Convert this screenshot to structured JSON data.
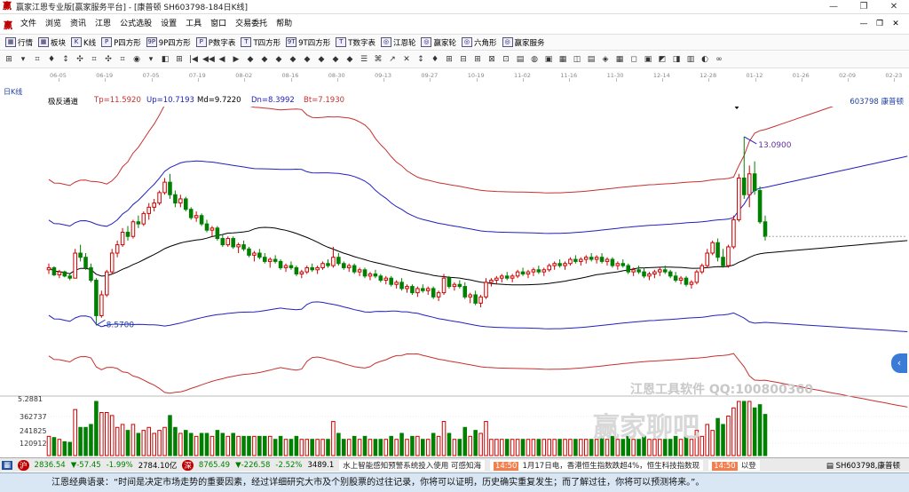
{
  "window": {
    "title": "赢家江恩专业版[赢家服务平台] - [康普顿  SH603798-184日K线]",
    "logo": "赢",
    "controls": [
      "—",
      "❐",
      "✕"
    ]
  },
  "menu": {
    "logo": "赢",
    "items": [
      "文件",
      "浏览",
      "资讯",
      "江恩",
      "公式选股",
      "设置",
      "工具",
      "窗口",
      "交易委托",
      "帮助"
    ],
    "mdi_controls": [
      "—",
      "❐",
      "✕"
    ]
  },
  "toolbar1": {
    "items": [
      {
        "icon": "grid-icon",
        "glyph": "▦",
        "label": "行情"
      },
      {
        "icon": "block-icon",
        "glyph": "▦",
        "label": "板块"
      },
      {
        "icon": "kline-icon",
        "glyph": "K",
        "label": "K线"
      },
      {
        "icon": "p-square-icon",
        "glyph": "P",
        "label": "P四方形"
      },
      {
        "icon": "9p-square-icon",
        "glyph": "9P",
        "label": "9P四方形"
      },
      {
        "icon": "p-number-icon",
        "glyph": "P",
        "label": "P数字表"
      },
      {
        "icon": "t-square-icon",
        "glyph": "T",
        "label": "T四方形"
      },
      {
        "icon": "9t-square-icon",
        "glyph": "9T",
        "label": "9T四方形"
      },
      {
        "icon": "t-number-icon",
        "glyph": "T",
        "label": "T数字表"
      },
      {
        "icon": "gann-wheel-icon",
        "glyph": "◎",
        "label": "江恩轮"
      },
      {
        "icon": "winner-wheel-icon",
        "glyph": "◎",
        "label": "赢家轮"
      },
      {
        "icon": "hexagon-icon",
        "glyph": "◎",
        "label": "六角形"
      },
      {
        "icon": "service-icon",
        "glyph": "◎",
        "label": "赢家服务"
      }
    ]
  },
  "toolbar2": {
    "glyphs": [
      "⊞",
      "▾",
      "⌗",
      "♦",
      "↕",
      "✣",
      "⌗",
      "✣",
      "⌗",
      "◉",
      "▾",
      "◧",
      "⊞",
      "|◀",
      "◀◀",
      "◀",
      "▶",
      "◆",
      "◆",
      "◆",
      "◆",
      "◆",
      "◆",
      "◆",
      "◆",
      "☰",
      "⌘",
      "↗",
      "✕",
      "↕",
      "♦",
      "⊞",
      "⊟",
      "⊞",
      "⊠",
      "⊡",
      "▤",
      "◍",
      "▣",
      "▦",
      "◫",
      "▤",
      "◈",
      "▦",
      "◻",
      "▣",
      "◩",
      "◨",
      "▥",
      "◐",
      "∞"
    ]
  },
  "date_axis": {
    "label": "日K线",
    "dates": [
      "06-05",
      "06-19",
      "07-05",
      "07-19",
      "08-02",
      "08-16",
      "08-30",
      "09-13",
      "09-27",
      "10-19",
      "11-02",
      "11-16",
      "11-30",
      "12-14",
      "12-28",
      "01-12",
      "01-26",
      "02-09",
      "02-23"
    ]
  },
  "indicator": {
    "name": "极反通道",
    "tp": "Tp=11.5920",
    "up": "Up=10.7193",
    "md": "Md=9.7220",
    "dn": "Dn=8.3992",
    "bt": "Bt=7.1930",
    "stock_code": "603798",
    "stock_name": "康普顿"
  },
  "colors": {
    "up": "#d00000",
    "down": "#008000",
    "upper_band": "#c83030",
    "mid_band": "#2020c0",
    "ma_line": "#000000"
  },
  "chart_data": {
    "type": "candlestick",
    "price_range": [
      7.0,
      13.6
    ],
    "annotations": {
      "high_label": "13.0900",
      "low_label": "8.5700",
      "volume_scale_top": "5.2881"
    },
    "volume_ticks": [
      "362737",
      "241825",
      "120912"
    ],
    "candles": [
      [
        9.9,
        10.05,
        9.8,
        9.95
      ],
      [
        9.95,
        9.98,
        9.75,
        9.78
      ],
      [
        9.78,
        9.9,
        9.7,
        9.85
      ],
      [
        9.85,
        9.88,
        9.72,
        9.75
      ],
      [
        9.75,
        9.8,
        9.65,
        9.7
      ],
      [
        9.7,
        10.4,
        9.7,
        10.3
      ],
      [
        10.3,
        10.5,
        10.1,
        10.2
      ],
      [
        10.2,
        10.3,
        9.9,
        9.95
      ],
      [
        9.95,
        10.05,
        9.6,
        9.65
      ],
      [
        9.65,
        9.7,
        8.57,
        8.8
      ],
      [
        8.8,
        9.4,
        8.75,
        9.3
      ],
      [
        9.3,
        9.9,
        9.25,
        9.85
      ],
      [
        9.85,
        10.4,
        9.8,
        10.3
      ],
      [
        10.3,
        10.6,
        10.2,
        10.5
      ],
      [
        10.5,
        10.9,
        10.45,
        10.8
      ],
      [
        10.8,
        10.95,
        10.6,
        10.7
      ],
      [
        10.7,
        11.1,
        10.65,
        11.05
      ],
      [
        11.05,
        11.2,
        10.9,
        11.0
      ],
      [
        11.0,
        11.3,
        10.95,
        11.25
      ],
      [
        11.25,
        11.5,
        11.1,
        11.4
      ],
      [
        11.4,
        11.6,
        11.3,
        11.5
      ],
      [
        11.5,
        11.8,
        11.45,
        11.75
      ],
      [
        11.75,
        12.1,
        11.7,
        12.0
      ],
      [
        12.0,
        12.2,
        11.6,
        11.7
      ],
      [
        11.7,
        11.8,
        11.4,
        11.5
      ],
      [
        11.5,
        11.7,
        11.4,
        11.6
      ],
      [
        11.6,
        11.65,
        11.3,
        11.35
      ],
      [
        11.35,
        11.4,
        11.1,
        11.15
      ],
      [
        11.15,
        11.3,
        11.05,
        11.2
      ],
      [
        11.2,
        11.25,
        10.95,
        11.0
      ],
      [
        11.0,
        11.1,
        10.8,
        10.85
      ],
      [
        10.85,
        10.95,
        10.7,
        10.9
      ],
      [
        10.9,
        10.95,
        10.6,
        10.65
      ],
      [
        10.65,
        10.75,
        10.45,
        10.5
      ],
      [
        10.5,
        10.7,
        10.45,
        10.65
      ],
      [
        10.65,
        10.7,
        10.4,
        10.45
      ],
      [
        10.45,
        10.55,
        10.3,
        10.5
      ],
      [
        10.5,
        10.6,
        10.35,
        10.4
      ],
      [
        10.4,
        10.45,
        10.2,
        10.25
      ],
      [
        10.25,
        10.35,
        10.1,
        10.3
      ],
      [
        10.3,
        10.4,
        10.15,
        10.2
      ],
      [
        10.2,
        10.3,
        10.05,
        10.1
      ],
      [
        10.1,
        10.2,
        9.95,
        10.15
      ],
      [
        10.15,
        10.25,
        10.05,
        10.1
      ],
      [
        10.1,
        10.15,
        9.9,
        9.95
      ],
      [
        9.95,
        10.05,
        9.85,
        10.0
      ],
      [
        10.0,
        10.1,
        9.9,
        9.95
      ],
      [
        9.95,
        10.0,
        9.75,
        9.8
      ],
      [
        9.8,
        9.9,
        9.7,
        9.85
      ],
      [
        9.85,
        10.0,
        9.8,
        9.95
      ],
      [
        9.95,
        10.05,
        9.85,
        9.9
      ],
      [
        9.9,
        10.0,
        9.8,
        9.95
      ],
      [
        9.95,
        10.1,
        9.9,
        10.05
      ],
      [
        10.05,
        10.15,
        9.95,
        10.0
      ],
      [
        10.0,
        10.45,
        9.95,
        10.2
      ],
      [
        10.2,
        10.3,
        10.0,
        10.05
      ],
      [
        10.05,
        10.1,
        9.9,
        9.95
      ],
      [
        9.95,
        10.05,
        9.85,
        10.0
      ],
      [
        10.0,
        10.05,
        9.8,
        9.85
      ],
      [
        9.85,
        9.95,
        9.75,
        9.9
      ],
      [
        9.9,
        9.95,
        9.7,
        9.75
      ],
      [
        9.75,
        9.85,
        9.65,
        9.8
      ],
      [
        9.8,
        9.9,
        9.7,
        9.75
      ],
      [
        9.75,
        9.8,
        9.6,
        9.65
      ],
      [
        9.65,
        9.75,
        9.55,
        9.7
      ],
      [
        9.7,
        9.75,
        9.5,
        9.55
      ],
      [
        9.55,
        9.65,
        9.45,
        9.6
      ],
      [
        9.6,
        9.7,
        9.4,
        9.45
      ],
      [
        9.45,
        9.55,
        9.35,
        9.5
      ],
      [
        9.5,
        9.55,
        9.3,
        9.35
      ],
      [
        9.35,
        9.5,
        9.25,
        9.45
      ],
      [
        9.45,
        9.55,
        9.35,
        9.4
      ],
      [
        9.4,
        9.5,
        9.3,
        9.45
      ],
      [
        9.45,
        9.5,
        9.2,
        9.25
      ],
      [
        9.25,
        9.4,
        9.15,
        9.35
      ],
      [
        9.35,
        9.8,
        9.3,
        9.7
      ],
      [
        9.7,
        9.75,
        9.45,
        9.5
      ],
      [
        9.5,
        9.6,
        9.4,
        9.55
      ],
      [
        9.55,
        9.65,
        9.45,
        9.5
      ],
      [
        9.5,
        9.6,
        9.2,
        9.25
      ],
      [
        9.25,
        9.35,
        9.1,
        9.3
      ],
      [
        9.3,
        9.4,
        9.05,
        9.1
      ],
      [
        9.1,
        9.3,
        9.0,
        9.25
      ],
      [
        9.25,
        9.7,
        9.2,
        9.6
      ],
      [
        9.6,
        9.7,
        9.5,
        9.65
      ],
      [
        9.65,
        9.75,
        9.55,
        9.7
      ],
      [
        9.7,
        9.8,
        9.6,
        9.75
      ],
      [
        9.75,
        9.85,
        9.65,
        9.7
      ],
      [
        9.7,
        9.8,
        9.6,
        9.75
      ],
      [
        9.75,
        9.9,
        9.7,
        9.85
      ],
      [
        9.85,
        9.95,
        9.75,
        9.8
      ],
      [
        9.8,
        9.9,
        9.7,
        9.85
      ],
      [
        9.85,
        9.95,
        9.75,
        9.9
      ],
      [
        9.9,
        10.0,
        9.8,
        9.85
      ],
      [
        9.85,
        9.95,
        9.75,
        9.9
      ],
      [
        9.9,
        10.05,
        9.85,
        10.0
      ],
      [
        10.0,
        10.1,
        9.9,
        10.05
      ],
      [
        10.05,
        10.15,
        9.95,
        10.0
      ],
      [
        10.0,
        10.1,
        9.9,
        10.05
      ],
      [
        10.05,
        10.2,
        10.0,
        10.15
      ],
      [
        10.15,
        10.25,
        10.05,
        10.1
      ],
      [
        10.1,
        10.2,
        10.0,
        10.15
      ],
      [
        10.15,
        10.25,
        10.05,
        10.2
      ],
      [
        10.2,
        10.3,
        10.1,
        10.15
      ],
      [
        10.15,
        10.25,
        10.05,
        10.2
      ],
      [
        10.2,
        10.3,
        10.05,
        10.1
      ],
      [
        10.1,
        10.2,
        10.0,
        10.15
      ],
      [
        10.15,
        10.2,
        9.95,
        10.0
      ],
      [
        10.0,
        10.1,
        9.9,
        10.05
      ],
      [
        10.05,
        10.15,
        9.95,
        10.0
      ],
      [
        10.0,
        10.05,
        9.8,
        9.85
      ],
      [
        9.85,
        9.95,
        9.75,
        9.9
      ],
      [
        9.9,
        10.0,
        9.8,
        9.85
      ],
      [
        9.85,
        9.95,
        9.7,
        9.75
      ],
      [
        9.75,
        9.85,
        9.65,
        9.8
      ],
      [
        9.8,
        9.9,
        9.7,
        9.85
      ],
      [
        9.85,
        9.95,
        9.75,
        9.9
      ],
      [
        9.9,
        10.0,
        9.8,
        9.85
      ],
      [
        9.85,
        9.9,
        9.7,
        9.75
      ],
      [
        9.75,
        9.85,
        9.6,
        9.65
      ],
      [
        9.65,
        9.75,
        9.55,
        9.7
      ],
      [
        9.7,
        9.75,
        9.5,
        9.55
      ],
      [
        9.55,
        9.65,
        9.45,
        9.6
      ],
      [
        9.6,
        9.9,
        9.55,
        9.85
      ],
      [
        9.85,
        10.05,
        9.8,
        10.0
      ],
      [
        10.0,
        10.4,
        9.95,
        10.3
      ],
      [
        10.3,
        10.6,
        10.25,
        10.55
      ],
      [
        10.55,
        10.65,
        10.1,
        10.2
      ],
      [
        10.2,
        10.4,
        9.95,
        10.0
      ],
      [
        10.0,
        10.5,
        9.95,
        10.45
      ],
      [
        10.45,
        11.2,
        10.4,
        11.1
      ],
      [
        11.1,
        12.2,
        11.05,
        12.1
      ],
      [
        12.1,
        13.09,
        11.6,
        11.7
      ],
      [
        11.7,
        12.4,
        11.4,
        12.2
      ],
      [
        12.2,
        12.5,
        11.7,
        11.8
      ],
      [
        11.8,
        11.9,
        11.0,
        11.05
      ],
      [
        11.05,
        11.2,
        10.6,
        10.7
      ]
    ]
  },
  "ticker": {
    "sh_index": "2836.54",
    "sh_change": "▼-57.45",
    "sh_pct": "-1.99%",
    "sh_amount": "2784.10亿",
    "sz_index": "8765.49",
    "sz_change": "▼-226.58",
    "sz_pct": "-2.52%",
    "sz_amount": "3489.1",
    "news1": "水上智能感知预警系统投入使用 可感知海",
    "news2_time": "14:50",
    "news2": "1月17日电，香港恒生指数跌超4%，恒生科技指数现",
    "news3_time": "14:50",
    "news3": "以登",
    "right_code": "SH603798,康普顿"
  },
  "quote": {
    "text": "江恩经典语录：“时间是决定市场走势的重要因素，经过详细研究大市及个别股票的过往记录，你将可以证明，历史确实重复发生；而了解过往，你将可以预测将来。”。"
  },
  "watermark": {
    "line1": "江恩工具软件  QQ:100800360",
    "line2": "赢家聊吧"
  }
}
